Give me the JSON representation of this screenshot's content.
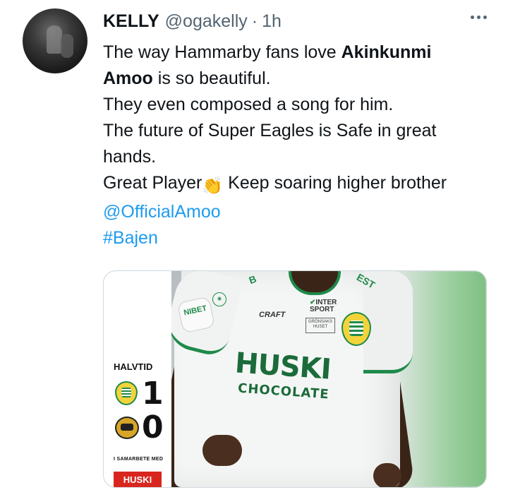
{
  "tweet": {
    "author_name": "KELLY",
    "author_handle": "@ogakelly",
    "separator": "·",
    "time": "1h",
    "lines": {
      "l1_prefix": "The way Hammarby fans love ",
      "l1_bold": "Akinkunmi",
      "l2_bold": "Amoo",
      "l2_suffix": " is so beautiful.",
      "l3": "They even composed a song for him.",
      "l4": "The future of Super Eagles is Safe in great",
      "l5": "hands.",
      "l6_prefix": "Great Player",
      "clap": "👏",
      "l6_suffix": " Keep soaring higher brother"
    },
    "mention": "@OfficialAmoo",
    "hashtag": "#Bajen"
  },
  "media": {
    "scoreboard": {
      "label": "HALVTID",
      "home_score": "1",
      "away_score": "0",
      "partner_text": "I SAMARBETE MED",
      "partner_logo": "HUSKI"
    },
    "jersey": {
      "sponsor_main": "HUSKI",
      "sponsor_sub": "CHOCOLATE",
      "brand": "CRAFT",
      "intersport_1": "INTER",
      "intersport_2": "SPORT",
      "gronsaks": "GRÖNSAKS HUSET",
      "sleeve": "NIBET",
      "collar_left": "B",
      "collar_right": "EST"
    }
  },
  "colors": {
    "link": "#1d9bf0",
    "secondary_text": "#536471",
    "hammarby_green": "#1f8a4a"
  }
}
